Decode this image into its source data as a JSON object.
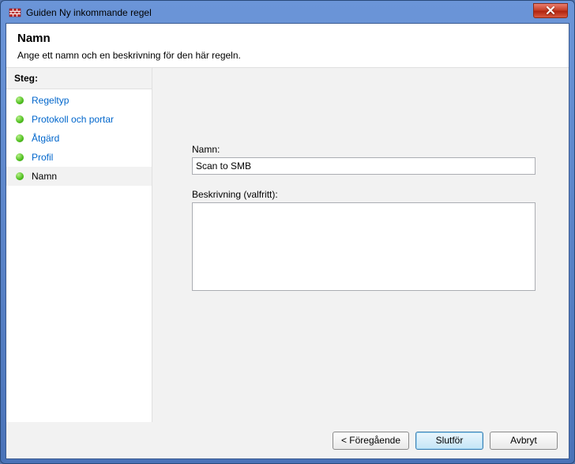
{
  "window": {
    "title": "Guiden Ny inkommande regel"
  },
  "header": {
    "title": "Namn",
    "description": "Ange ett namn och en beskrivning för den här regeln."
  },
  "sidebar": {
    "steps_title": "Steg:",
    "items": [
      {
        "label": "Regeltyp"
      },
      {
        "label": "Protokoll och portar"
      },
      {
        "label": "Åtgärd"
      },
      {
        "label": "Profil"
      },
      {
        "label": "Namn"
      }
    ],
    "current_index": 4
  },
  "form": {
    "name_label": "Namn:",
    "name_value": "Scan to SMB",
    "desc_label": "Beskrivning (valfritt):",
    "desc_value": ""
  },
  "footer": {
    "back": "< Föregående",
    "finish": "Slutför",
    "cancel": "Avbryt"
  }
}
